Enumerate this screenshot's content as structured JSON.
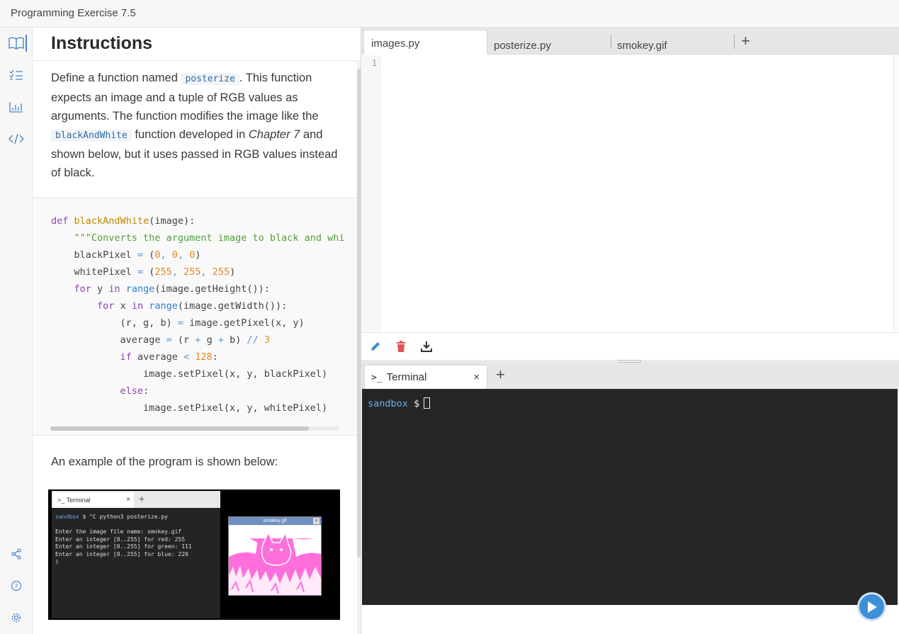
{
  "app": {
    "title": "Programming Exercise 7.5"
  },
  "instructions": {
    "heading": "Instructions",
    "p1_a": "Define a function named ",
    "p1_code1": "posterize",
    "p1_b": ". This function expects an image and a tuple of RGB values as arguments. The function modifies the image like the ",
    "p1_code2": "blackAndWhite",
    "p1_c": " function developed in ",
    "p1_em": "Chapter 7",
    "p1_d": " and shown below, but it uses passed in RGB values instead of black.",
    "example_text": "An example of the program is shown below:"
  },
  "code": {
    "l1_kw": "def",
    "l1_fn": "blackAndWhite",
    "l1_arg": "(image):",
    "l2_str": "\"\"\"Converts the argument image to black and whi",
    "l3": "blackPixel",
    "l3_vals": [
      "0",
      "0",
      "0"
    ],
    "l4": "whitePixel",
    "l4_vals": [
      "255",
      "255",
      "255"
    ],
    "l5_kw": "for",
    "l5_var": "y",
    "l5_in": "in",
    "l5_range": "range",
    "l5_rest": "(image.getHeight()):",
    "l6_var": "x",
    "l6_rest": "(image.getWidth()):",
    "l7_a": "(r, g, b)",
    "l7_b": "image.getPixel(x, y)",
    "l8_a": "average",
    "l8_b": "(r",
    "l8_c": "g",
    "l8_d": "b)",
    "l8_div": "//",
    "l8_num": "3",
    "l9_kw": "if",
    "l9_a": "average",
    "l9_num": "128",
    "l10": "image.setPixel(x, y, blackPixel)",
    "l11_kw": "else",
    "l12": "image.setPixel(x, y, whitePixel)"
  },
  "demo": {
    "tab_label": ">_ Terminal",
    "tab_close": "×",
    "tab_plus": "+",
    "prompt": "sandbox",
    "cmd": " $ ^C python3 posterize.py",
    "lines": [
      "Enter the image file name: smokey.gif",
      "Enter an integer [0..255] for red: 255",
      "Enter an integer [0..255] for green: 111",
      "Enter an integer [0..255] for blue: 220"
    ],
    "window_title": "smokey.gif",
    "window_close": "×"
  },
  "editor": {
    "tabs": [
      {
        "label": "images.py",
        "active": true
      },
      {
        "label": "posterize.py",
        "active": false
      },
      {
        "label": "smokey.gif",
        "active": false
      }
    ],
    "add_tab": "+",
    "line_number": "1"
  },
  "terminal": {
    "tab_label": "Terminal",
    "tab_glyph": ">_",
    "tab_close": "×",
    "add_tab": "+",
    "prompt": "sandbox",
    "prompt_sign": "$"
  },
  "icons": {
    "rail": [
      "book-icon",
      "checklist-icon",
      "chart-icon",
      "code-icon",
      "share-icon",
      "help-icon",
      "settings-icon"
    ],
    "tools": [
      "pencil-icon",
      "trash-icon",
      "download-icon"
    ],
    "run": "play-icon"
  },
  "colors": {
    "accent": "#4a86c5",
    "terminal_bg": "#262626",
    "prompt": "#6aaeea",
    "trash": "#e05555",
    "run": "#3d8fd8"
  }
}
